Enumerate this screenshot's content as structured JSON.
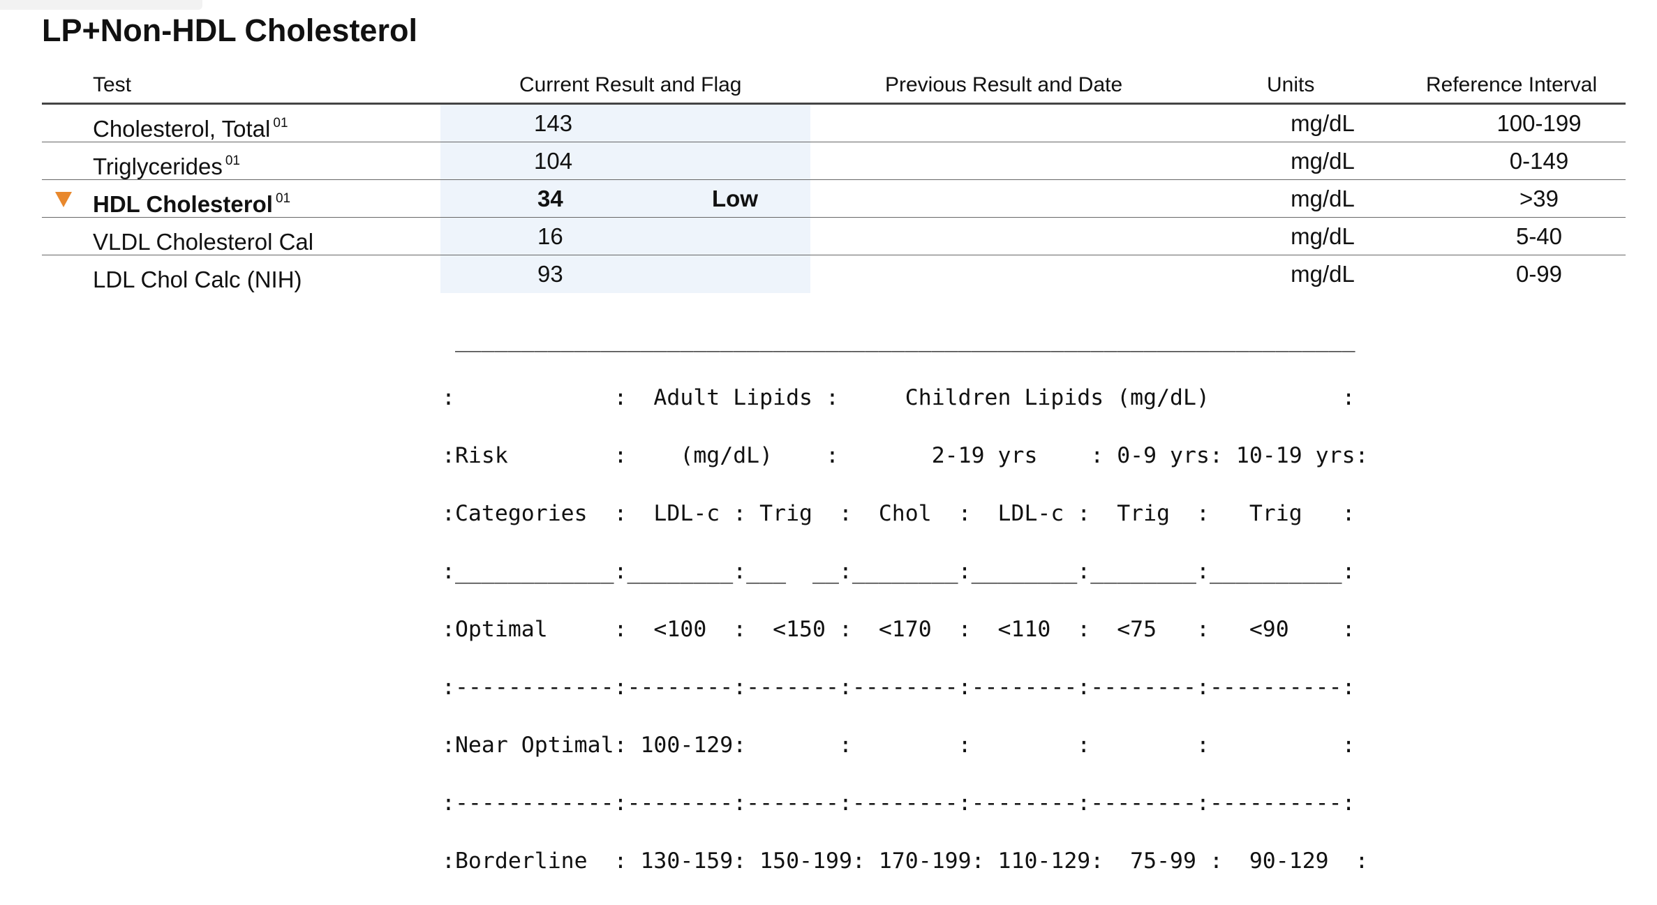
{
  "title": "LP+Non-HDL Cholesterol",
  "columns": {
    "test": "Test",
    "current": "Current Result and Flag",
    "previous": "Previous Result and Date",
    "units": "Units",
    "reference": "Reference Interval"
  },
  "rows": [
    {
      "test": "Cholesterol, Total",
      "sup": "01",
      "result": "143",
      "flag": "",
      "units": "mg/dL",
      "reference": "100-199"
    },
    {
      "test": "Triglycerides",
      "sup": "01",
      "result": "104",
      "flag": "",
      "units": "mg/dL",
      "reference": "0-149"
    },
    {
      "test": "HDL Cholesterol",
      "sup": "01",
      "result": "34",
      "flag": "Low",
      "units": "mg/dL",
      "reference": ">39"
    },
    {
      "test": "VLDL Cholesterol Cal",
      "sup": "",
      "result": "16",
      "flag": "",
      "units": "mg/dL",
      "reference": "5-40"
    },
    {
      "test": "LDL Chol Calc (NIH)",
      "sup": "",
      "result": "93",
      "flag": "",
      "units": "mg/dL",
      "reference": "0-99"
    }
  ],
  "colors": {
    "flag_low": "#e8882d",
    "result_shade": "#eef4fb"
  },
  "flag_icon": "triangle-down-icon",
  "comment_lines": [
    " ____________________________________________________________________",
    ":            :  Adult Lipids :     Children Lipids (mg/dL)          :",
    ":Risk        :    (mg/dL)    :       2-19 yrs    : 0-9 yrs: 10-19 yrs:",
    ":Categories  :  LDL-c : Trig  :  Chol  :  LDL-c :  Trig  :   Trig   :",
    ":____________:________:___  __:________:________:________:__________:",
    ":Optimal     :  <100  :  <150 :  <170  :  <110  :  <75   :   <90    :",
    ":------------:--------:-------:--------:--------:--------:----------:",
    ":Near Optimal: 100-129:       :        :        :        :          :",
    ":------------:--------:-------:--------:--------:--------:----------:",
    ":Borderline  : 130-159: 150-199: 170-199: 110-129:  75-99 :  90-129  :"
  ]
}
